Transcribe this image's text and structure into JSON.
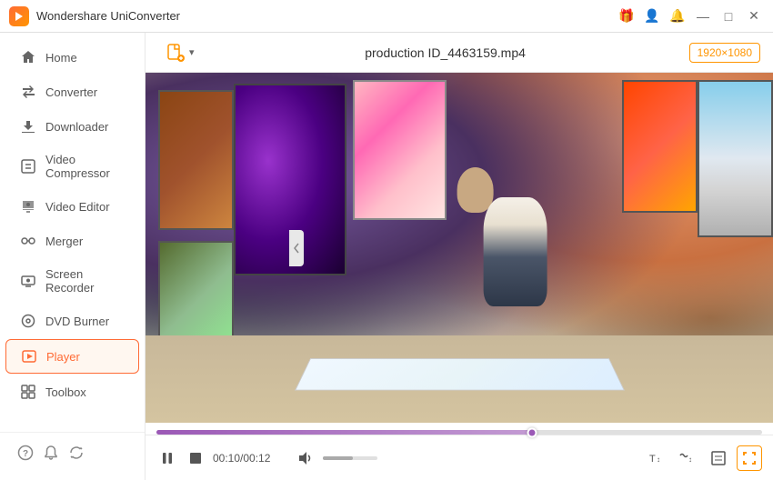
{
  "app": {
    "title": "Wondershare UniConverter",
    "logo_color": "#ff6b35"
  },
  "titlebar": {
    "gift_icon": "🎁",
    "user_icon": "👤",
    "bell_icon": "🔔",
    "minimize_icon": "—",
    "maximize_icon": "□",
    "close_icon": "✕"
  },
  "sidebar": {
    "items": [
      {
        "id": "home",
        "label": "Home",
        "icon": "⌂",
        "active": false
      },
      {
        "id": "converter",
        "label": "Converter",
        "icon": "⇄",
        "active": false
      },
      {
        "id": "downloader",
        "label": "Downloader",
        "icon": "↓",
        "active": false
      },
      {
        "id": "video-compressor",
        "label": "Video Compressor",
        "icon": "⊡",
        "active": false
      },
      {
        "id": "video-editor",
        "label": "Video Editor",
        "icon": "✂",
        "active": false
      },
      {
        "id": "merger",
        "label": "Merger",
        "icon": "⊕",
        "active": false
      },
      {
        "id": "screen-recorder",
        "label": "Screen Recorder",
        "icon": "⊙",
        "active": false
      },
      {
        "id": "dvd-burner",
        "label": "DVD Burner",
        "icon": "⊚",
        "active": false
      },
      {
        "id": "player",
        "label": "Player",
        "icon": "▶",
        "active": true
      },
      {
        "id": "toolbox",
        "label": "Toolbox",
        "icon": "⊞",
        "active": false
      }
    ],
    "bottom_icons": [
      "?",
      "🔔",
      "↺"
    ]
  },
  "topbar": {
    "add_file_icon": "📁",
    "add_file_label": "",
    "file_name": "production ID_4463159.mp4",
    "resolution": "1920×1080",
    "dropdown_arrow": "▾"
  },
  "player": {
    "progress_percent": 62,
    "time_current": "00:10/00:12",
    "volume_percent": 55
  },
  "controls": {
    "pause": "⏸",
    "stop": "■",
    "time": "00:10/00:12",
    "volume_icon": "🔊",
    "subtitle": "T↕",
    "audio": "♪↕",
    "crop": "⊡",
    "fullscreen": "⤢"
  }
}
